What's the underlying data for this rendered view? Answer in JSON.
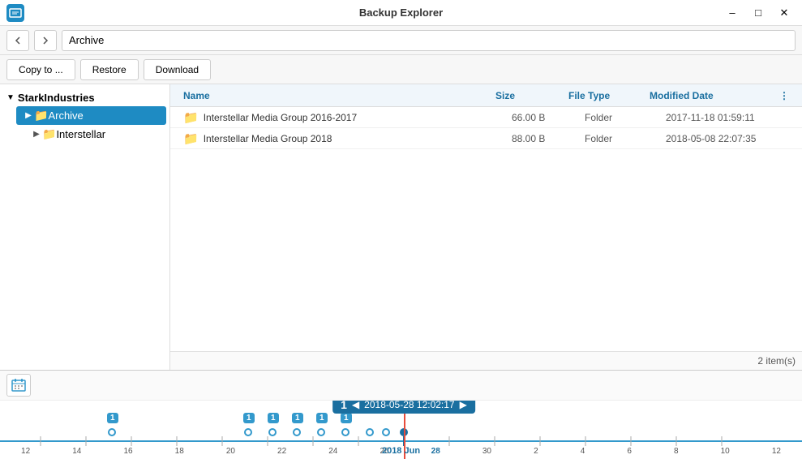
{
  "window": {
    "title": "Backup Explorer",
    "icon_label": "backup-icon"
  },
  "nav": {
    "back_label": "‹",
    "forward_label": "›",
    "path_value": "Archive"
  },
  "toolbar": {
    "copy_label": "Copy to ...",
    "restore_label": "Restore",
    "download_label": "Download"
  },
  "sidebar": {
    "root_label": "StarkIndustries",
    "items": [
      {
        "id": "archive",
        "label": "Archive",
        "selected": true,
        "icon": "folder"
      },
      {
        "id": "interstellar",
        "label": "Interstellar",
        "selected": false,
        "icon": "folder"
      }
    ]
  },
  "filelist": {
    "columns": {
      "name": "Name",
      "size": "Size",
      "filetype": "File Type",
      "modified": "Modified Date"
    },
    "rows": [
      {
        "name": "Interstellar Media Group 2016-2017",
        "size": "66.00 B",
        "type": "Folder",
        "date": "2017-11-18 01:59:11"
      },
      {
        "name": "Interstellar Media Group 2018",
        "size": "88.00 B",
        "type": "Folder",
        "date": "2018-05-08 22:07:35"
      }
    ],
    "item_count": "2 item(s)"
  },
  "timeline": {
    "popup_num": "1",
    "popup_datetime": "2018-05-28 12:02:17",
    "june_label": "2018 Jun",
    "labels": [
      "12",
      "14",
      "16",
      "18",
      "20",
      "22",
      "24",
      "26",
      "28",
      "30",
      "2",
      "4",
      "6",
      "8",
      "10",
      "12"
    ],
    "dots": [
      {
        "pos_pct": 14,
        "active": false
      },
      {
        "pos_pct": 31,
        "active": false
      },
      {
        "pos_pct": 34,
        "active": false
      },
      {
        "pos_pct": 37,
        "active": false
      },
      {
        "pos_pct": 40,
        "active": false
      },
      {
        "pos_pct": 43,
        "active": false
      },
      {
        "pos_pct": 46,
        "active": false
      },
      {
        "pos_pct": 49,
        "active": false
      },
      {
        "pos_pct": 52,
        "active": true
      }
    ],
    "redline_pct": 52
  }
}
